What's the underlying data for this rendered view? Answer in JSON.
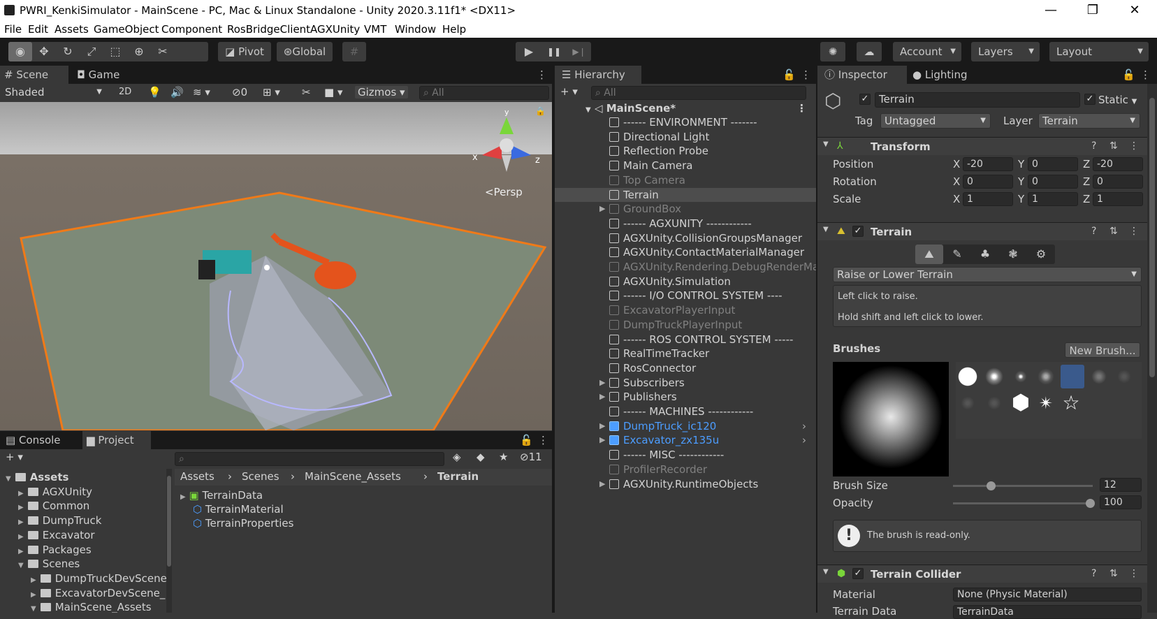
{
  "window": {
    "title": "PWRI_KenkiSimulator - MainScene - PC, Mac & Linux Standalone - Unity 2020.3.11f1* <DX11>",
    "minimize": "—",
    "maximize": "❐",
    "close": "✕"
  },
  "menu": [
    "File",
    "Edit",
    "Assets",
    "GameObject",
    "Component",
    "RosBridgeClient",
    "AGXUnity",
    "VMT",
    "Window",
    "Help"
  ],
  "toolbar": {
    "pivot": "Pivot",
    "global": "Global",
    "account": "Account",
    "layers": "Layers",
    "layout": "Layout",
    "play": "▶",
    "pause": "❚❚",
    "step": "▶❘"
  },
  "scene": {
    "tab_scene": "Scene",
    "tab_game": "Game",
    "shading": "Shaded",
    "mode2d": "2D",
    "hidden_count": "0",
    "gizmos": "Gizmos",
    "search_placeholder": "All",
    "persp": "Persp",
    "axis_x": "x",
    "axis_z": "z",
    "axis_y": "y"
  },
  "hierarchy": {
    "tab": "Hierarchy",
    "search_placeholder": "All",
    "scene_name": "MainScene*",
    "items": [
      {
        "label": "------ ENVIRONMENT -------",
        "style": "normal",
        "expand": false
      },
      {
        "label": "Directional Light",
        "style": "normal",
        "expand": false
      },
      {
        "label": "Reflection Probe",
        "style": "normal",
        "expand": false
      },
      {
        "label": "Main Camera",
        "style": "normal",
        "expand": false
      },
      {
        "label": "Top Camera",
        "style": "dim",
        "expand": false
      },
      {
        "label": "Terrain",
        "style": "selected",
        "expand": false
      },
      {
        "label": "GroundBox",
        "style": "dim",
        "expand": true
      },
      {
        "label": "------ AGXUNITY ------------",
        "style": "normal",
        "expand": false
      },
      {
        "label": "AGXUnity.CollisionGroupsManager",
        "style": "normal",
        "expand": false
      },
      {
        "label": "AGXUnity.ContactMaterialManager",
        "style": "normal",
        "expand": false
      },
      {
        "label": "AGXUnity.Rendering.DebugRenderManager",
        "style": "dim",
        "expand": false
      },
      {
        "label": "AGXUnity.Simulation",
        "style": "normal",
        "expand": false
      },
      {
        "label": "------ I/O CONTROL SYSTEM ----",
        "style": "normal",
        "expand": false
      },
      {
        "label": "ExcavatorPlayerInput",
        "style": "dim",
        "expand": false
      },
      {
        "label": "DumpTruckPlayerInput",
        "style": "dim",
        "expand": false
      },
      {
        "label": "------ ROS CONTROL SYSTEM -----",
        "style": "normal",
        "expand": false
      },
      {
        "label": "RealTimeTracker",
        "style": "normal",
        "expand": false
      },
      {
        "label": "RosConnector",
        "style": "normal",
        "expand": false
      },
      {
        "label": "Subscribers",
        "style": "normal",
        "expand": true
      },
      {
        "label": "Publishers",
        "style": "normal",
        "expand": true
      },
      {
        "label": "------ MACHINES ------------",
        "style": "normal",
        "expand": false
      },
      {
        "label": "DumpTruck_ic120",
        "style": "blue",
        "expand": true
      },
      {
        "label": "Excavator_zx135u",
        "style": "blue",
        "expand": true
      },
      {
        "label": "------ MISC ------------",
        "style": "normal",
        "expand": false
      },
      {
        "label": "ProfilerRecorder",
        "style": "dim",
        "expand": false
      },
      {
        "label": "AGXUnity.RuntimeObjects",
        "style": "normal",
        "expand": true
      }
    ]
  },
  "inspector": {
    "tab_inspector": "Inspector",
    "tab_lighting": "Lighting",
    "object_name": "Terrain",
    "static_label": "Static",
    "tag_label": "Tag",
    "tag_value": "Untagged",
    "layer_label": "Layer",
    "layer_value": "Terrain",
    "transform": {
      "title": "Transform",
      "position_label": "Position",
      "rotation_label": "Rotation",
      "scale_label": "Scale",
      "pos": [
        "-20",
        "0",
        "-20"
      ],
      "rot": [
        "0",
        "0",
        "0"
      ],
      "scale": [
        "1",
        "1",
        "1"
      ],
      "x": "X",
      "y": "Y",
      "z": "Z"
    },
    "terrain": {
      "title": "Terrain",
      "tool": "Raise or Lower Terrain",
      "help1": "Left click to raise.",
      "help2": "Hold shift and left click to lower.",
      "brushes_label": "Brushes",
      "new_brush": "New Brush...",
      "brush_size_label": "Brush Size",
      "brush_size": "12",
      "brush_size_fraction": 0.25,
      "opacity_label": "Opacity",
      "opacity": "100",
      "opacity_fraction": 1.0,
      "readonly_msg": "The brush is read-only."
    },
    "collider": {
      "title": "Terrain Collider",
      "material_label": "Material",
      "material_value": "None (Physic Material)",
      "terrain_data_label": "Terrain Data",
      "terrain_data_value": "TerrainData"
    }
  },
  "bottom": {
    "tab_console": "Console",
    "tab_project": "Project",
    "hidden_count": "11",
    "tree": [
      {
        "label": "Assets",
        "indent": 0,
        "open": true,
        "bold": true
      },
      {
        "label": "AGXUnity",
        "indent": 1
      },
      {
        "label": "Common",
        "indent": 1
      },
      {
        "label": "DumpTruck",
        "indent": 1
      },
      {
        "label": "Excavator",
        "indent": 1
      },
      {
        "label": "Packages",
        "indent": 1
      },
      {
        "label": "Scenes",
        "indent": 1,
        "open": true
      },
      {
        "label": "DumpTruckDevScene",
        "indent": 2
      },
      {
        "label": "ExcavatorDevScene_",
        "indent": 2
      },
      {
        "label": "MainScene_Assets",
        "indent": 2,
        "open": true
      }
    ],
    "breadcrumb": [
      "Assets",
      "Scenes",
      "MainScene_Assets",
      "Terrain"
    ],
    "files": [
      "TerrainData",
      "TerrainMaterial",
      "TerrainProperties"
    ]
  }
}
